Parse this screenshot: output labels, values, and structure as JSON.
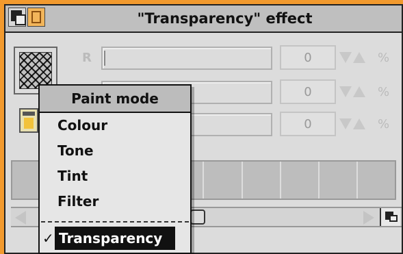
{
  "window": {
    "title": "\"Transparency\" effect"
  },
  "rows": [
    {
      "label": "R",
      "value": "0",
      "unit": "%"
    },
    {
      "label": "",
      "value": "0",
      "unit": "%"
    },
    {
      "label": "",
      "value": "0",
      "unit": "%"
    }
  ],
  "menu": {
    "title": "Paint mode",
    "items": [
      "Colour",
      "Tone",
      "Tint",
      "Filter"
    ],
    "checked_item": "Transparency",
    "check_mark": "✓"
  },
  "colors": {
    "background": "#f29a2e",
    "window": "#dcdcdc",
    "title_bar": "#bfbfbf",
    "highlight": "#111111"
  }
}
